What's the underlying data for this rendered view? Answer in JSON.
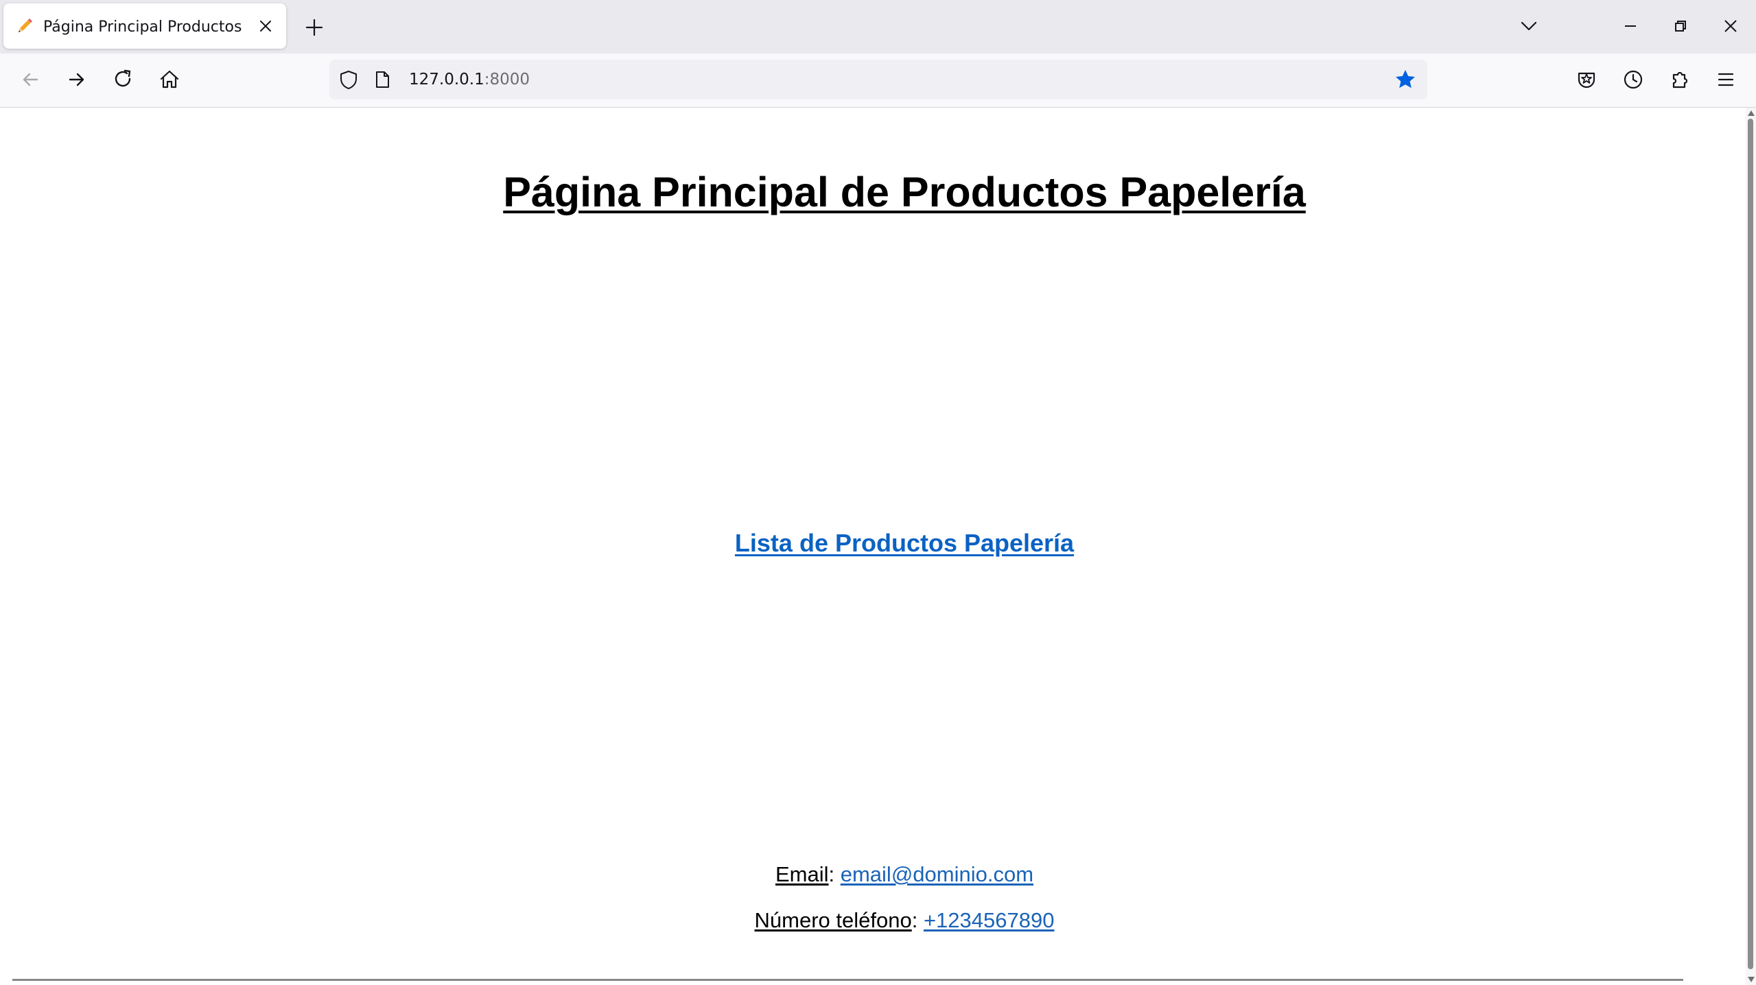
{
  "browser": {
    "tab": {
      "title": "Página Principal Productos",
      "favicon": "pencil-icon"
    },
    "url": {
      "host": "127.0.0.1",
      "port": ":8000"
    },
    "icons": {
      "new_tab": "plus-icon",
      "tab_list": "chevron-down-icon",
      "back": "arrow-left-icon",
      "forward": "arrow-right-icon",
      "reload": "reload-icon",
      "home": "home-icon",
      "tracking_protection": "shield-icon",
      "page_info": "page-icon",
      "bookmark": "star-icon",
      "pocket": "save-to-pocket-icon",
      "history": "clock-icon",
      "extensions": "puzzle-icon",
      "menu": "hamburger-icon"
    },
    "colors": {
      "tabstrip": "#e9e9ee",
      "navbar": "#f9f9fb",
      "urlbar": "#f0f0f4",
      "bookmark_star": "#0061e0"
    }
  },
  "page": {
    "title": "Página Principal de Productos Papelería",
    "main_link": "Lista de Productos Papelería",
    "contact": {
      "email_label": "Email",
      "email_separator": ":",
      "email_value": "email@dominio.com",
      "phone_label": "Número teléfono",
      "phone_separator": ":",
      "phone_value": "+1234567890"
    },
    "colors": {
      "link": "#0b62c3",
      "text": "#000000"
    }
  }
}
